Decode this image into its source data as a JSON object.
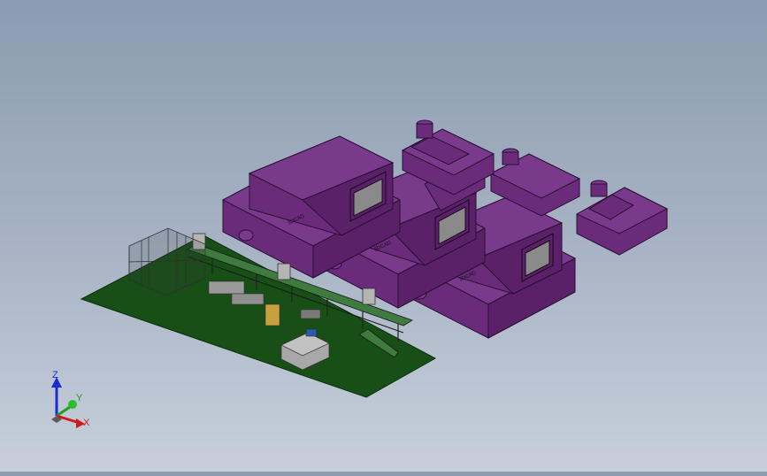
{
  "viewport": {
    "machine_text": "3DCAD",
    "colors": {
      "machine_body": "#6a2c7a",
      "machine_top": "#7a3a8c",
      "machine_side": "#5a2168",
      "floor": "#174f17",
      "frame": "#2a2a2a",
      "conveyor": "#3f7a3f",
      "cabinet": "#b5b5b5"
    }
  },
  "triad": {
    "z_label": "Z",
    "y_label": "Y",
    "x_label": "X",
    "colors": {
      "z": "#1a2bd0",
      "y": "#1aa01a",
      "x": "#d01a1a"
    }
  }
}
